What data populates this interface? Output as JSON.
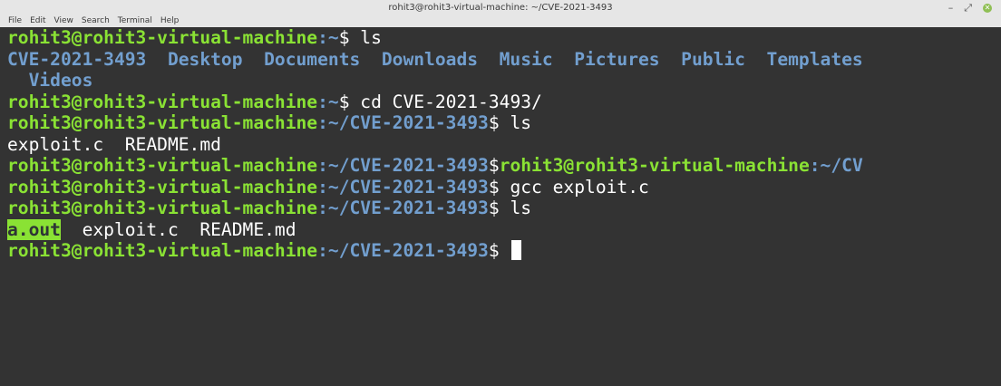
{
  "window": {
    "title": "rohit3@rohit3-virtual-machine: ~/CVE-2021-3493",
    "menu": [
      "File",
      "Edit",
      "View",
      "Search",
      "Terminal",
      "Help"
    ],
    "controls": {
      "minimize": "–",
      "maximize": "⤢",
      "close": "✕"
    },
    "close_color": "#8fbf54"
  },
  "terminal": {
    "colors": {
      "background": "#333333",
      "prompt": "#8ae234",
      "directory": "#729fcf",
      "text": "#ffffff"
    },
    "user_host": "rohit3@rohit3-virtual-machine",
    "line1": {
      "path": ":~",
      "tail": "$ ls"
    },
    "ls1": {
      "row1": "CVE-2021-3493  Desktop  Documents  Downloads  Music  Pictures  Public  Templates",
      "row2": "  Videos"
    },
    "line2": {
      "path": ":~",
      "tail": "$ cd CVE-2021-3493/"
    },
    "line3": {
      "path": ":~/CVE-2021-3493",
      "tail": "$ ls"
    },
    "ls2": "exploit.c  README.md",
    "line4": {
      "path": ":~/CVE-2021-3493",
      "sep": "$",
      "user2": "rohit3@rohit3-virtual-machine",
      "path2": ":~/CV"
    },
    "line5": {
      "path": ":~/CVE-2021-3493",
      "tail": "$ gcc exploit.c"
    },
    "line6": {
      "path": ":~/CVE-2021-3493",
      "tail": "$ ls"
    },
    "ls3": {
      "exec": "a.out",
      "rest": "  exploit.c  README.md"
    },
    "line7": {
      "path": ":~/CVE-2021-3493",
      "tail": "$ "
    }
  }
}
